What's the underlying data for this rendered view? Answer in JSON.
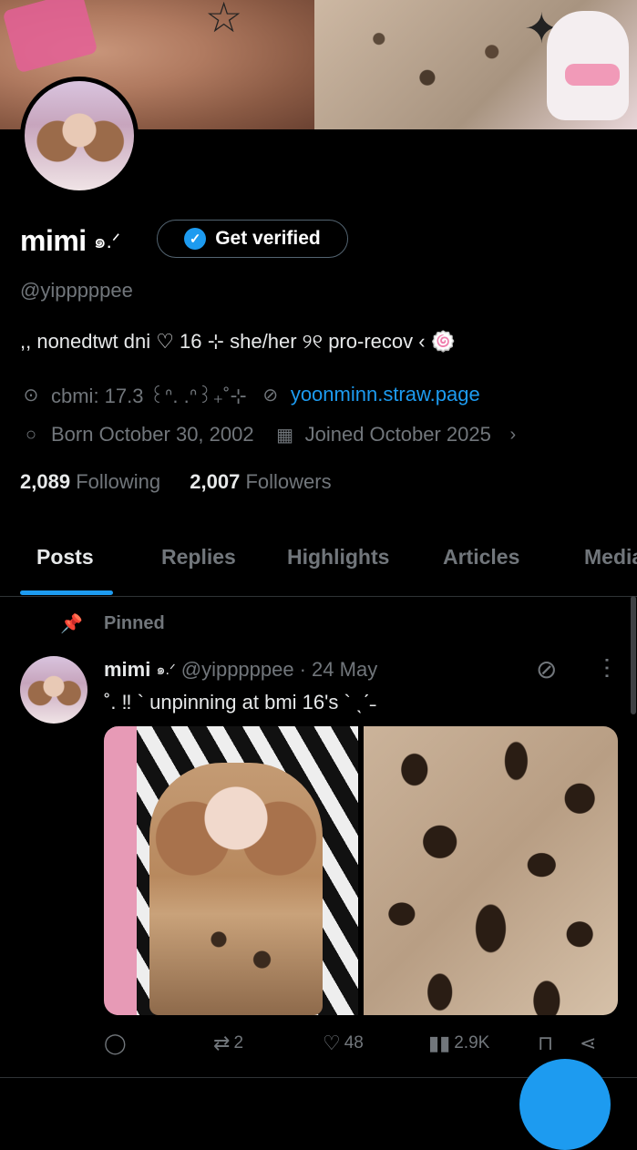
{
  "profile": {
    "display_name": "mimi",
    "name_decoration": "๑.ᐟ",
    "get_verified_label": "Get verified",
    "handle": "@yipppppee",
    "bio": ",, nonedtwt dni  ♡  16  ⊹  she/her   ୨୧   pro-recov  ‹ 🍥",
    "location": "cbmi: 17.3  ꒰ᐢ. .ᐢ꒱₊˚⊹",
    "website": "yoonminn.straw.page",
    "born": "Born October 30, 2002",
    "joined": "Joined October 2025",
    "following_count": "2,089",
    "following_label": "Following",
    "followers_count": "2,007",
    "followers_label": "Followers"
  },
  "tabs": [
    "Posts",
    "Replies",
    "Highlights",
    "Articles",
    "Media"
  ],
  "active_tab": "Posts",
  "pinned_post": {
    "pinned_label": "Pinned",
    "author_name": "mimi",
    "author_decoration": "๑.ᐟ",
    "author_handle": "@yipppppee",
    "date": "· 24 May",
    "text": "˚. ‼ ` unpinning at bmi 16's `   ˎˊ˗",
    "replies": "",
    "reposts": "2",
    "likes": "48",
    "views": "2.9K"
  },
  "icons": {
    "location": "location-pin-icon",
    "link": "link-icon",
    "born": "balloon-icon",
    "joined": "calendar-icon",
    "pin": "pin-icon",
    "grok": "grok-icon",
    "more": "more-icon",
    "reply": "reply-icon",
    "repost": "repost-icon",
    "like": "heart-icon",
    "views": "views-icon",
    "bookmark": "bookmark-icon",
    "share": "share-icon"
  },
  "colors": {
    "accent": "#1d9bf0",
    "background": "#000000",
    "muted_text": "#71767b",
    "primary_text": "#e7e9ea"
  }
}
